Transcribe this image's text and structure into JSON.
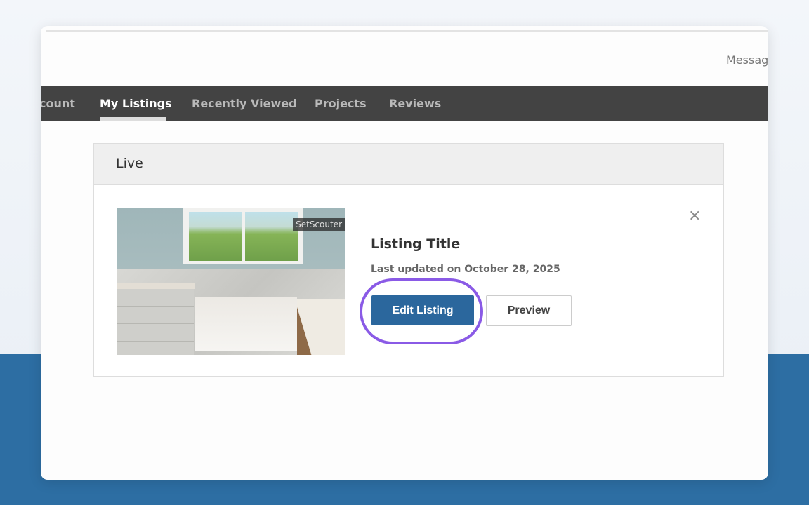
{
  "header": {
    "messages_label": "Messag"
  },
  "nav": {
    "tabs": [
      {
        "label": "count"
      },
      {
        "label": "My Listings",
        "active": true
      },
      {
        "label": "Recently Viewed"
      },
      {
        "label": "Projects"
      },
      {
        "label": "Reviews"
      }
    ]
  },
  "section": {
    "title": "Live"
  },
  "listing": {
    "title": "Listing Title",
    "updated": "Last updated on October 28, 2025",
    "watermark": "SetScouter",
    "edit_label": "Edit Listing",
    "preview_label": "Preview",
    "close_icon": "×"
  },
  "colors": {
    "accent": "#2b679d",
    "highlight_ring": "#8a5ae6",
    "nav_bg": "#434343",
    "band": "#2d6ea3"
  }
}
